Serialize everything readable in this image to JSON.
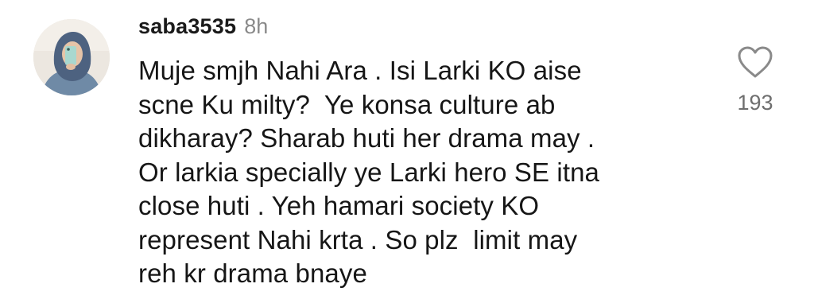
{
  "comment": {
    "username": "saba3535",
    "time": "8h",
    "text_lines": [
      "Muje smjh Nahi Ara . Isi Larki KO aise",
      "scne Ku milty?  Ye konsa culture ab",
      "dikharay? Sharab huti her drama may .",
      "Or larkia specially ye Larki hero SE itna",
      "close huti . Yeh hamari society KO",
      "represent Nahi krta . So plz  limit may",
      "reh kr drama bnaye"
    ],
    "like_icon": "heart-outline-icon",
    "like_count": "193"
  },
  "colors": {
    "text": "#161616",
    "muted": "#8a8a8a",
    "background": "#ffffff"
  }
}
